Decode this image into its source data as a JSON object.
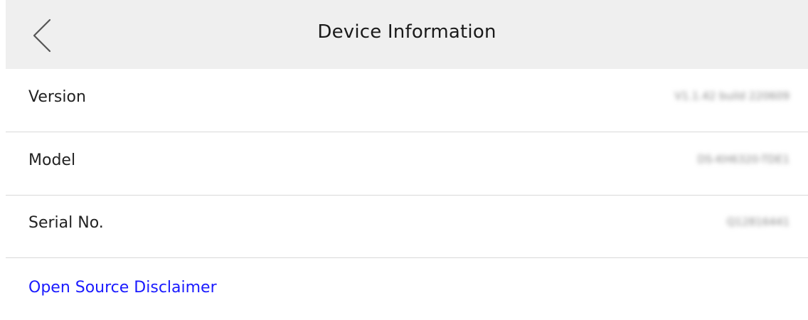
{
  "header": {
    "title": "Device Information",
    "back_icon": "chevron-left-icon"
  },
  "rows": [
    {
      "label": "Version",
      "value": "V1.1.42 build 220609"
    },
    {
      "label": "Model",
      "value": "DS-KH6320-TDE1"
    },
    {
      "label": "Serial No.",
      "value": "Q12816441"
    }
  ],
  "footer": {
    "link_label": "Open Source Disclaimer",
    "link_color": "#1a1aff"
  },
  "colors": {
    "header_bg": "#efefef",
    "divider": "#d9d9d9",
    "text": "#222222"
  }
}
